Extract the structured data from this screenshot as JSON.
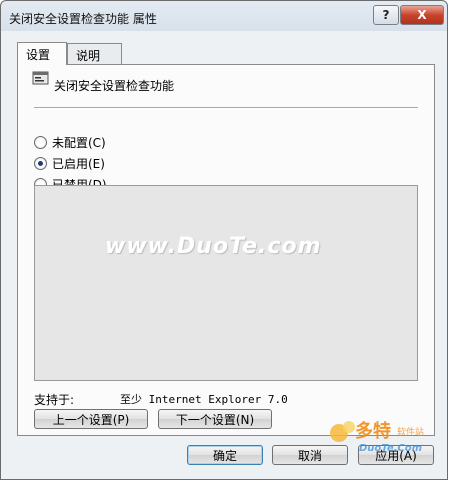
{
  "window": {
    "title": "关闭安全设置检查功能 属性"
  },
  "titlebar": {
    "help_label": "?",
    "close_label": "X"
  },
  "tabs": [
    {
      "label": "设置"
    },
    {
      "label": "说明"
    }
  ],
  "policy": {
    "name": "关闭安全设置检查功能",
    "icon": "policy-setting-icon"
  },
  "options": [
    {
      "label": "未配置(C)",
      "checked": false
    },
    {
      "label": "已启用(E)",
      "checked": true
    },
    {
      "label": "已禁用(D)",
      "checked": false
    }
  ],
  "watermark": "www.DuoTe.com",
  "supported": {
    "label": "支持于:",
    "value": "至少 Internet Explorer 7.0"
  },
  "nav": {
    "prev_label": "上一个设置(P)",
    "next_label": "下一个设置(N)"
  },
  "footer": {
    "ok_label": "确定",
    "cancel_label": "取消",
    "apply_label": "应用(A)"
  },
  "logo": {
    "brand": "多特",
    "tagline": "软件站",
    "site": "DuoTe.Com"
  },
  "colors": {
    "close_button": "#c8442c",
    "accent": "#1c3b77"
  }
}
